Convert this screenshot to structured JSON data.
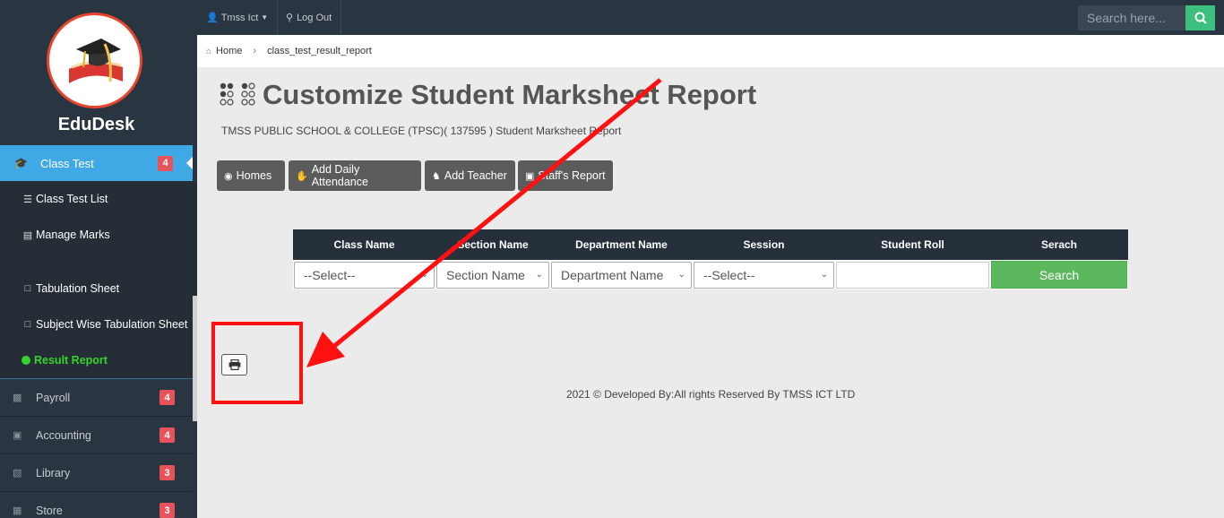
{
  "sidebar": {
    "brand": "EduDesk",
    "active_item": {
      "label": "Class Test",
      "badge": "4"
    },
    "sub_items": [
      {
        "label": "Class Test List",
        "icon": "list-icon"
      },
      {
        "label": "Manage Marks",
        "icon": "document-icon"
      },
      {
        "label": "Tabulation Sheet",
        "icon": "file-icon"
      },
      {
        "label": "Subject Wise Tabulation Sheet",
        "icon": "file-icon"
      },
      {
        "label": "Result Report",
        "icon": "dot-icon"
      }
    ],
    "nav_items": [
      {
        "label": "Payroll",
        "badge": "4",
        "icon": "money-icon"
      },
      {
        "label": "Accounting",
        "badge": "4",
        "icon": "briefcase-icon"
      },
      {
        "label": "Library",
        "badge": "3",
        "icon": "book-icon"
      },
      {
        "label": "Store",
        "badge": "3",
        "icon": "store-icon"
      }
    ]
  },
  "topbar": {
    "user": "Tmss Ict",
    "logout": "Log Out",
    "search_placeholder": "Search here..."
  },
  "breadcrumb": {
    "home": "Home",
    "current": "class_test_result_report"
  },
  "page": {
    "title": "Customize Student Marksheet Report",
    "subtitle": "TMSS PUBLIC SCHOOL & COLLEGE (TPSC)( 137595 ) Student Marksheet Report"
  },
  "buttons": {
    "homes": "Homes",
    "attendance": "Add Daily Attendance",
    "teacher": "Add Teacher",
    "staffs": "Staff's Report"
  },
  "filter": {
    "headers": [
      "Class Name",
      "Section Name",
      "Department Name",
      "Session",
      "Student Roll",
      "Serach"
    ],
    "class_value": "--Select--",
    "section_value": "Section Name",
    "department_value": "Department Name",
    "session_value": "--Select--",
    "search_label": "Search"
  },
  "footer": "2021 © Developed By:All rights Reserved By TMSS ICT LTD",
  "colors": {
    "annotation": "#ff1111",
    "accent": "#3fa9e6",
    "success": "#5cb85c"
  }
}
